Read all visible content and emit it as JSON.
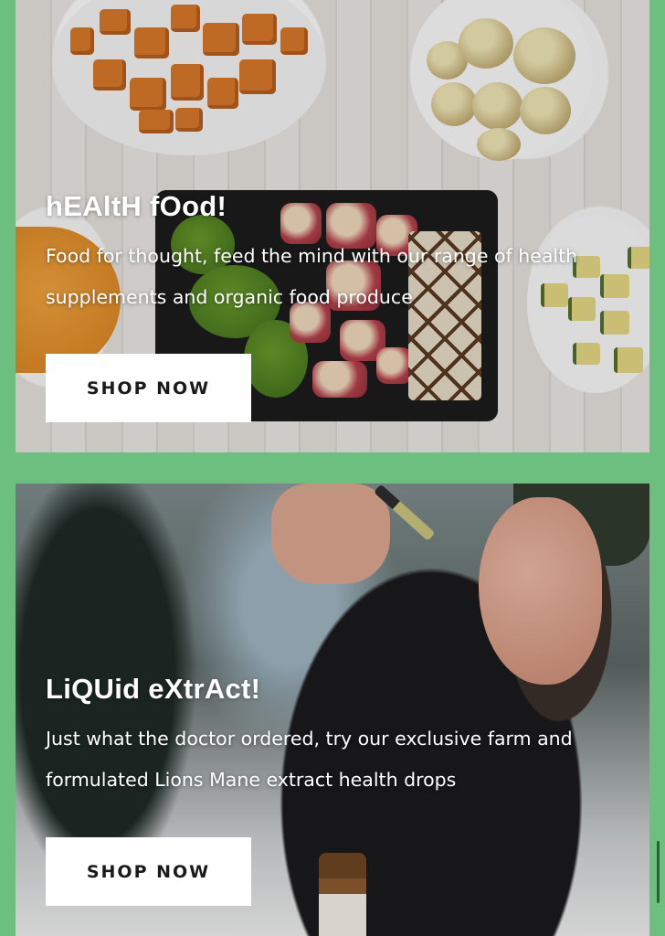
{
  "cards": [
    {
      "title": "hEAltH fOod!",
      "description": "Food for thought, feed the mind with our range of health supplements and organic food produce",
      "button_label": "SHOP NOW"
    },
    {
      "title": "LiQUid eXtrAct!",
      "description": "Just what the doctor ordered, try our exclusive farm and formulated Lions Mane extract health drops",
      "button_label": "SHOP NOW"
    }
  ],
  "colors": {
    "page_background": "#6cbf7f",
    "button_background": "#ffffff",
    "button_text": "#1a1a1a",
    "heading_text": "#ffffff"
  }
}
